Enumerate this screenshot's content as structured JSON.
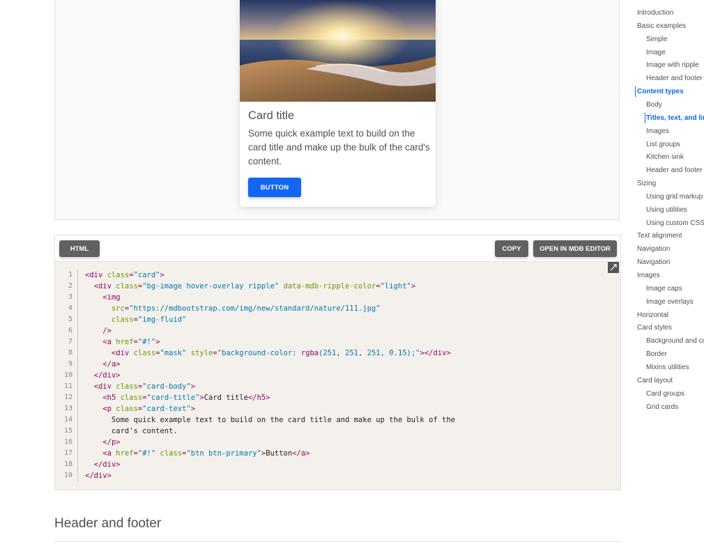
{
  "preview": {
    "card": {
      "image_alt": "beach sunset",
      "title": "Card title",
      "text": "Some quick example text to build on the card title and make up the bulk of the card's content.",
      "button_label": "BUTTON"
    }
  },
  "code_panel": {
    "tab_label": "HTML",
    "copy_label": "COPY",
    "open_editor_label": "OPEN IN MDB EDITOR",
    "copy_icon": "copy-icon",
    "lines": [
      {
        "n": "1",
        "segs": [
          [
            "t",
            "<div "
          ],
          [
            "a",
            "class"
          ],
          [
            "t",
            "="
          ],
          [
            "s",
            "\"card\""
          ],
          [
            "t",
            ">"
          ]
        ]
      },
      {
        "n": "2",
        "segs": [
          [
            "x",
            "  "
          ],
          [
            "t",
            "<div "
          ],
          [
            "a",
            "class"
          ],
          [
            "t",
            "="
          ],
          [
            "s",
            "\"bg-image hover-overlay ripple\""
          ],
          [
            "x",
            " "
          ],
          [
            "a",
            "data-mdb-ripple-color"
          ],
          [
            "t",
            "="
          ],
          [
            "s",
            "\"light\""
          ],
          [
            "t",
            ">"
          ]
        ]
      },
      {
        "n": "3",
        "segs": [
          [
            "x",
            "    "
          ],
          [
            "t",
            "<img"
          ]
        ]
      },
      {
        "n": "4",
        "segs": [
          [
            "x",
            "      "
          ],
          [
            "a",
            "src"
          ],
          [
            "t",
            "="
          ],
          [
            "s",
            "\"https://mdbootstrap.com/img/new/standard/nature/111.jpg\""
          ]
        ]
      },
      {
        "n": "5",
        "segs": [
          [
            "x",
            "      "
          ],
          [
            "a",
            "class"
          ],
          [
            "t",
            "="
          ],
          [
            "s",
            "\"img-fluid\""
          ]
        ]
      },
      {
        "n": "6",
        "segs": [
          [
            "x",
            "    "
          ],
          [
            "t",
            "/>"
          ]
        ]
      },
      {
        "n": "7",
        "segs": [
          [
            "x",
            "    "
          ],
          [
            "t",
            "<a "
          ],
          [
            "a",
            "href"
          ],
          [
            "t",
            "="
          ],
          [
            "s",
            "\"#!\""
          ],
          [
            "t",
            ">"
          ]
        ]
      },
      {
        "n": "8",
        "segs": [
          [
            "x",
            "      "
          ],
          [
            "t",
            "<div "
          ],
          [
            "a",
            "class"
          ],
          [
            "t",
            "="
          ],
          [
            "s",
            "\"mask\""
          ],
          [
            "x",
            " "
          ],
          [
            "a",
            "style"
          ],
          [
            "t",
            "="
          ],
          [
            "s",
            "\"background-color: "
          ],
          [
            "t",
            "rgba"
          ],
          [
            "s",
            "(251, 251, 251, 0.15);\""
          ],
          [
            "t",
            "></div>"
          ]
        ]
      },
      {
        "n": "9",
        "segs": [
          [
            "x",
            "    "
          ],
          [
            "t",
            "</a>"
          ]
        ]
      },
      {
        "n": "10",
        "segs": [
          [
            "x",
            "  "
          ],
          [
            "t",
            "</div>"
          ]
        ]
      },
      {
        "n": "11",
        "segs": [
          [
            "x",
            "  "
          ],
          [
            "t",
            "<div "
          ],
          [
            "a",
            "class"
          ],
          [
            "t",
            "="
          ],
          [
            "s",
            "\"card-body\""
          ],
          [
            "t",
            ">"
          ]
        ]
      },
      {
        "n": "12",
        "segs": [
          [
            "x",
            "    "
          ],
          [
            "t",
            "<h5 "
          ],
          [
            "a",
            "class"
          ],
          [
            "t",
            "="
          ],
          [
            "s",
            "\"card-title\""
          ],
          [
            "t",
            ">"
          ],
          [
            "x",
            "Card title"
          ],
          [
            "t",
            "</h5>"
          ]
        ]
      },
      {
        "n": "13",
        "segs": [
          [
            "x",
            "    "
          ],
          [
            "t",
            "<p "
          ],
          [
            "a",
            "class"
          ],
          [
            "t",
            "="
          ],
          [
            "s",
            "\"card-text\""
          ],
          [
            "t",
            ">"
          ]
        ]
      },
      {
        "n": "14",
        "segs": [
          [
            "x",
            "      Some quick example text to build on the card title and make up the bulk of the"
          ]
        ]
      },
      {
        "n": "15",
        "segs": [
          [
            "x",
            "      card's content."
          ]
        ]
      },
      {
        "n": "16",
        "segs": [
          [
            "x",
            "    "
          ],
          [
            "t",
            "</p>"
          ]
        ]
      },
      {
        "n": "17",
        "segs": [
          [
            "x",
            "    "
          ],
          [
            "t",
            "<a "
          ],
          [
            "a",
            "href"
          ],
          [
            "t",
            "="
          ],
          [
            "s",
            "\"#!\""
          ],
          [
            "x",
            " "
          ],
          [
            "a",
            "class"
          ],
          [
            "t",
            "="
          ],
          [
            "s",
            "\"btn btn-primary\""
          ],
          [
            "t",
            ">"
          ],
          [
            "x",
            "Button"
          ],
          [
            "t",
            "</a>"
          ]
        ]
      },
      {
        "n": "18",
        "segs": [
          [
            "x",
            "  "
          ],
          [
            "t",
            "</div>"
          ]
        ]
      },
      {
        "n": "19",
        "segs": [
          [
            "t",
            "</div>"
          ]
        ]
      }
    ]
  },
  "section_heading": "Header and footer",
  "toc": {
    "items": [
      {
        "label": "Introduction",
        "level": 0
      },
      {
        "label": "Basic examples",
        "level": 0
      },
      {
        "label": "Simple",
        "level": 1
      },
      {
        "label": "Image",
        "level": 1
      },
      {
        "label": "Image with ripple",
        "level": 1
      },
      {
        "label": "Header and footer",
        "level": 1
      },
      {
        "label": "Content types",
        "level": 0,
        "active": true
      },
      {
        "label": "Body",
        "level": 1
      },
      {
        "label": "Titles, text, and links",
        "level": 1,
        "active": true
      },
      {
        "label": "Images",
        "level": 1
      },
      {
        "label": "List groups",
        "level": 1
      },
      {
        "label": "Kitchen sink",
        "level": 1
      },
      {
        "label": "Header and footer",
        "level": 1
      },
      {
        "label": "Sizing",
        "level": 0
      },
      {
        "label": "Using grid markup",
        "level": 1
      },
      {
        "label": "Using utilities",
        "level": 1
      },
      {
        "label": "Using custom CSS",
        "level": 1
      },
      {
        "label": "Text alignment",
        "level": 0
      },
      {
        "label": "Navigation",
        "level": 0
      },
      {
        "label": "Navigation",
        "level": 0
      },
      {
        "label": "Images",
        "level": 0
      },
      {
        "label": "Image caps",
        "level": 1
      },
      {
        "label": "Image overlays",
        "level": 1
      },
      {
        "label": "Horizontal",
        "level": 0
      },
      {
        "label": "Card styles",
        "level": 0
      },
      {
        "label": "Background and colors",
        "level": 1
      },
      {
        "label": "Border",
        "level": 1
      },
      {
        "label": "Mixins utilities",
        "level": 1
      },
      {
        "label": "Card layout",
        "level": 0
      },
      {
        "label": "Card groups",
        "level": 1
      },
      {
        "label": "Grid cards",
        "level": 1
      }
    ]
  },
  "colors": {
    "primary": "#1266f1",
    "toolbar_button": "#616161",
    "code_bg": "#f4f1ed"
  }
}
